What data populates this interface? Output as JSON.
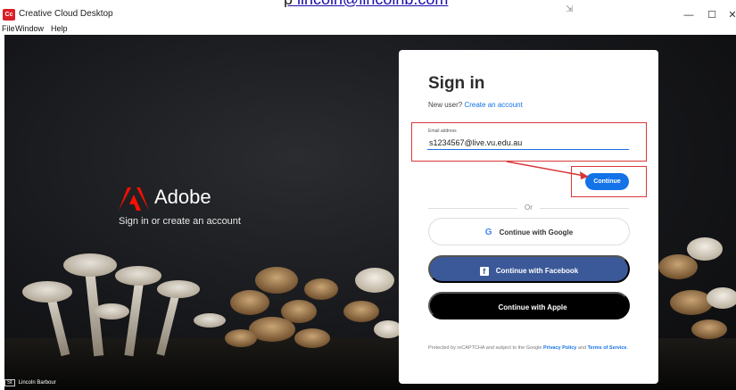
{
  "page_top": {
    "cut_text_plain": "p",
    "cut_text_link": "lincoln@lincolnb.com"
  },
  "window": {
    "title": "Creative Cloud Desktop",
    "app_icon_text": "Cc",
    "minimize_glyph": "—",
    "maximize_glyph": "☐",
    "close_glyph": "✕",
    "cursor_glyph": "⇲"
  },
  "menu": {
    "file": "File",
    "window": "Window",
    "help": "Help"
  },
  "brand": {
    "name": "Adobe",
    "subtitle": "Sign in or create an account",
    "logo_color": "#fa0f00"
  },
  "signin": {
    "title": "Sign in",
    "new_user_prefix": "New user? ",
    "create_account_link": "Create an account",
    "email_label": "Email address",
    "email_value": "s1234567@live.vu.edu.au",
    "continue_label": "Continue",
    "or_text": "Or",
    "google_icon": "G",
    "google_label": "Continue with Google",
    "facebook_icon": "f",
    "facebook_label": "Continue with Facebook",
    "apple_icon": "",
    "apple_label": "Continue with Apple",
    "legal_prefix": "Protected by reCAPTCHA and subject to the Google ",
    "privacy_link": "Privacy Policy",
    "legal_and": " and ",
    "terms_link": "Terms of Service",
    "legal_suffix": "."
  },
  "taskbar": {
    "badge": "St",
    "user": "Lincoln Barbour"
  },
  "colors": {
    "accent": "#1473e6",
    "facebook": "#3b5998",
    "annotation": "#d9383a"
  }
}
